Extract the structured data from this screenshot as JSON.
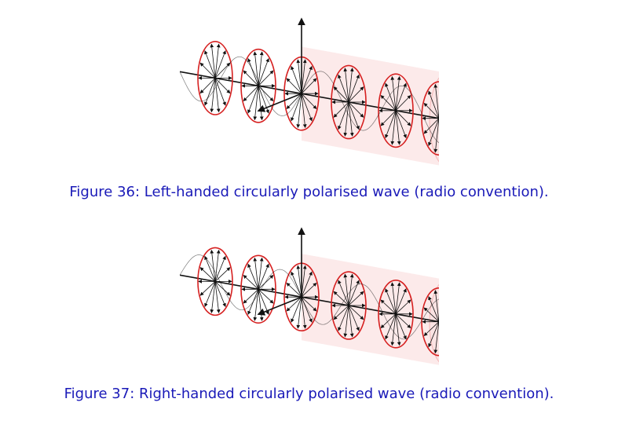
{
  "figures": [
    {
      "label": "Figure 36:",
      "caption": "Left-handed circularly polarised wave (radio convention).",
      "handedness": "left"
    },
    {
      "label": "Figure 37:",
      "caption": "Right-handed circularly polarised wave (radio convention).",
      "handedness": "right"
    }
  ],
  "colors": {
    "caption": "#1a1ab8",
    "ring": "#d62020",
    "cylinder_fill": "#fbe3e3",
    "vector": "#111111"
  }
}
